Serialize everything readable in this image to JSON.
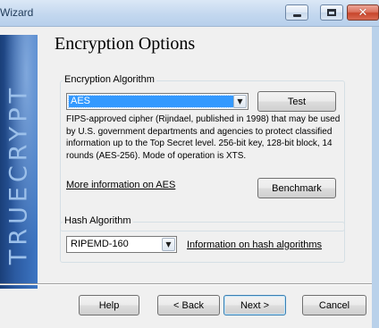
{
  "window": {
    "title": "Wizard",
    "minimize_label": "",
    "maximize_label": "",
    "close_glyph": "✕"
  },
  "banner": {
    "text": "TRUECRYPT"
  },
  "page": {
    "title": "Encryption Options"
  },
  "encryption_algorithm": {
    "group_label": "Encryption Algorithm",
    "selected": "AES",
    "test_button": "Test",
    "description": "FIPS-approved cipher (Rijndael, published in 1998) that may be used by U.S. government departments and agencies to protect classified information up to the Top Secret level. 256-bit key, 128-bit block, 14 rounds (AES-256). Mode of operation is XTS.",
    "more_info_link": "More information on AES",
    "benchmark_button": "Benchmark"
  },
  "hash_algorithm": {
    "group_label": "Hash Algorithm",
    "selected": "RIPEMD-160",
    "info_link": "Information on hash algorithms"
  },
  "footer": {
    "help": "Help",
    "back": "< Back",
    "next": "Next >",
    "cancel": "Cancel"
  },
  "colors": {
    "selection": "#3399ff",
    "banner": "#2b5aa1",
    "close_button": "#c8452b"
  }
}
